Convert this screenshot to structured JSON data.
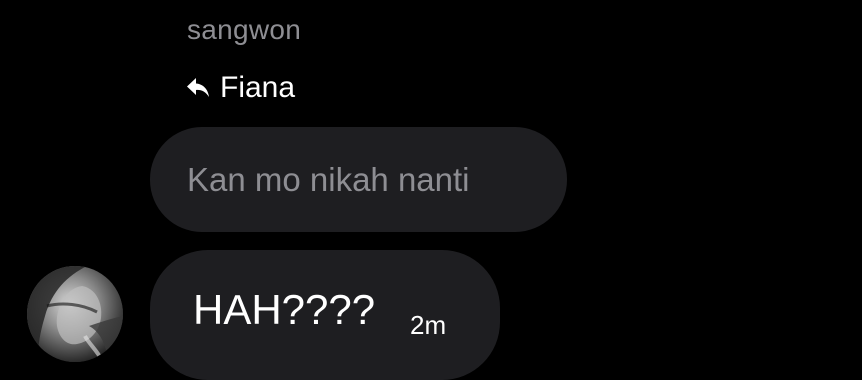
{
  "message": {
    "sender_name": "sangwon",
    "reply": {
      "icon": "reply-arrow-icon",
      "replied_to_name": "Fiana",
      "quoted_text": "Kan mo nikah nanti"
    },
    "text": "HAH????",
    "timestamp": "2m"
  },
  "colors": {
    "background": "#000000",
    "bubble": "#1e1e21",
    "muted_text": "#8e8e93",
    "primary_text": "#ffffff"
  }
}
